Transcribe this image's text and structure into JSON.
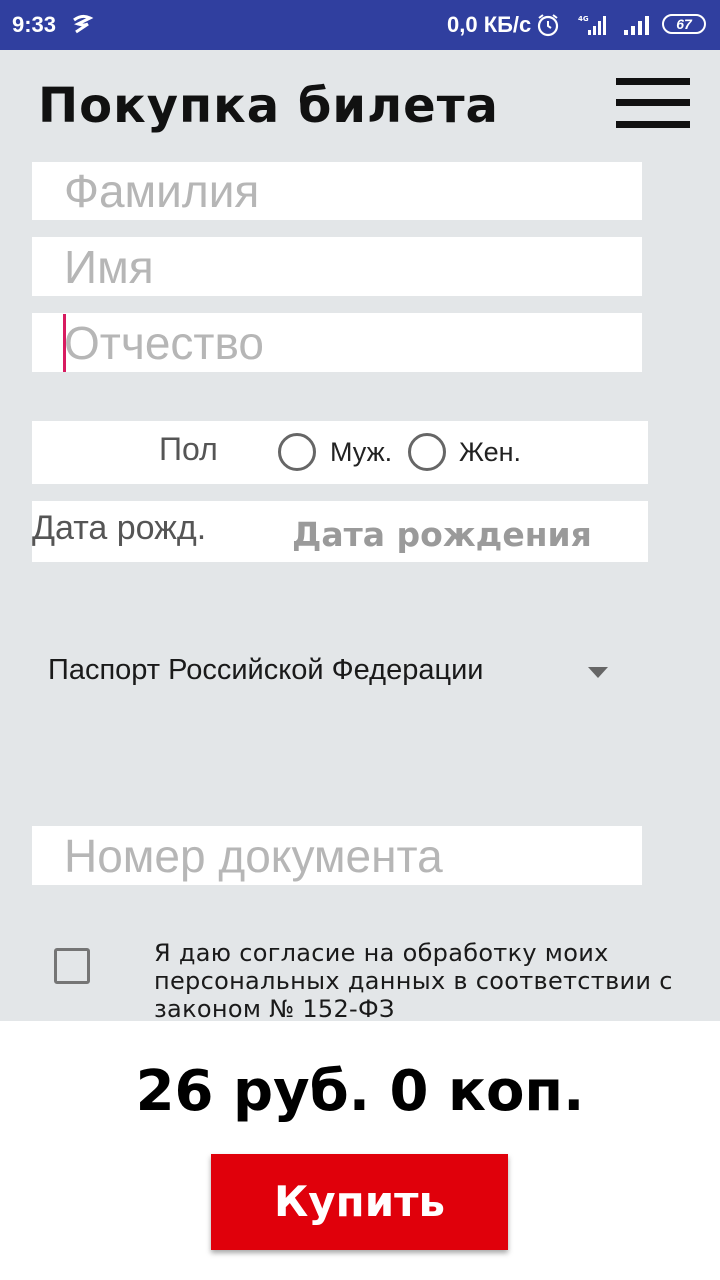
{
  "status_bar": {
    "time": "9:33",
    "network_speed": "0,0 КБ/с",
    "battery": "67",
    "icons": [
      "notification-icon",
      "alarm-icon",
      "signal-4g-icon",
      "signal-icon",
      "battery-icon"
    ]
  },
  "header": {
    "title": "Покупка билета",
    "menu_icon": "hamburger-menu-icon"
  },
  "form": {
    "surname_placeholder": "Фамилия",
    "name_placeholder": "Имя",
    "patronymic_placeholder": "Отчество",
    "gender_label": "Пол",
    "gender_male": "Муж.",
    "gender_female": "Жен.",
    "dob_label": "Дата рожд.",
    "dob_placeholder": "Дата рождения",
    "document_type": "Паспорт Российской Федерации",
    "document_number_placeholder": "Номер документа",
    "consent_text": "Я даю согласие на обработку моих персональных данных в соответствии с законом № 152-ФЗ"
  },
  "footer": {
    "price": "26 руб. 0 коп.",
    "buy_label": "Купить"
  },
  "colors": {
    "status_bar": "#303f9f",
    "background": "#e3e6e8",
    "buy_button": "#e0000b",
    "cursor": "#d81b60"
  }
}
